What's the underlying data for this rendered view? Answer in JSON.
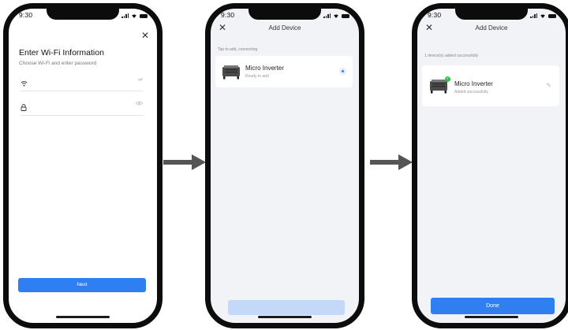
{
  "status_bar": {
    "time": "9:30"
  },
  "screen_1": {
    "title": "Enter Wi-Fi Information",
    "subtitle": "Choose Wi-Fi and enter password",
    "wifi_placeholder": "",
    "password_placeholder": "",
    "next_label": "Next"
  },
  "screen_2": {
    "header_title": "Add Device",
    "hint": "Tap to add, connecting",
    "device_name": "Micro Inverter",
    "device_status": "Ready to add",
    "button_label": ""
  },
  "screen_3": {
    "header_title": "Add Device",
    "hint": "1 device(s) added successfully",
    "device_name": "Micro Inverter",
    "device_status": "Added successfully",
    "done_label": "Done"
  },
  "colors": {
    "primary": "#2f7ff2",
    "primary_disabled": "#c4d8f8",
    "success": "#2fbf4a",
    "screen_bg": "#f2f3f6",
    "arrow": "#555555"
  }
}
